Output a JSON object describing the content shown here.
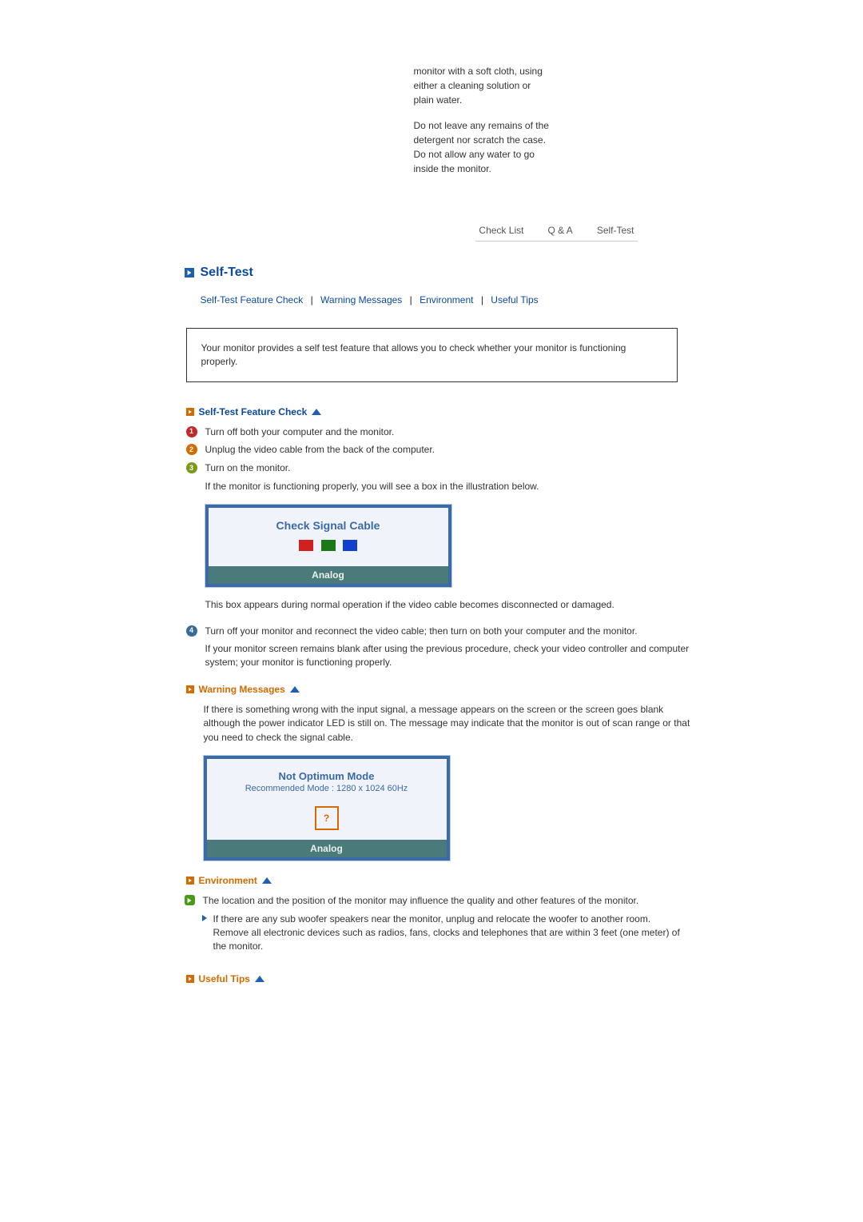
{
  "intro": {
    "p1": "monitor with a soft cloth, using either a cleaning solution or plain water.",
    "p2": "Do not leave any remains of the detergent nor scratch the case. Do not allow any water to go inside the monitor."
  },
  "subnav": {
    "check_list": "Check List",
    "qa": "Q & A",
    "self_test": "Self-Test"
  },
  "section_title": "Self-Test",
  "anchors": {
    "feature_check": "Self-Test Feature Check",
    "warning": "Warning Messages",
    "environment": "Environment",
    "tips": "Useful Tips"
  },
  "callout": "Your monitor provides a self test feature that allows you to check whether your monitor is functioning properly.",
  "feature": {
    "heading": "Self-Test Feature Check",
    "step1": "Turn off both your computer and the monitor.",
    "step2": "Unplug the video cable from the back of the computer.",
    "step3": "Turn on the monitor.",
    "step3_note": "If the monitor is functioning properly, you will see a box in the illustration below.",
    "osd_title": "Check Signal Cable",
    "osd_foot": "Analog",
    "after_osd_note": "This box appears during normal operation if the video cable becomes disconnected or damaged.",
    "step4": "Turn off your monitor and reconnect the video cable; then turn on both your computer and the monitor.",
    "step4_note": "If your monitor screen remains blank after using the previous procedure, check your video controller and computer system; your monitor is functioning properly."
  },
  "warning": {
    "heading": "Warning Messages",
    "para": "If there is something wrong with the input signal, a message appears on the screen or the screen goes blank although the power indicator LED is still on. The message may indicate that the monitor is out of scan range or that you need to check the signal cable.",
    "osd_title": "Not Optimum Mode",
    "osd_sub": "Recommended Mode : 1280 x 1024  60Hz",
    "osd_qmark": "?",
    "osd_foot": "Analog"
  },
  "environment": {
    "heading": "Environment",
    "bullet": "The location and the position of the monitor may influence the quality and other features of the monitor.",
    "sub_line1": "If there are any sub woofer speakers near the monitor, unplug and relocate the woofer to another room.",
    "sub_line2": "Remove all electronic devices such as radios, fans, clocks and telephones that are within 3 feet (one meter) of the monitor."
  },
  "tips": {
    "heading": "Useful Tips"
  }
}
